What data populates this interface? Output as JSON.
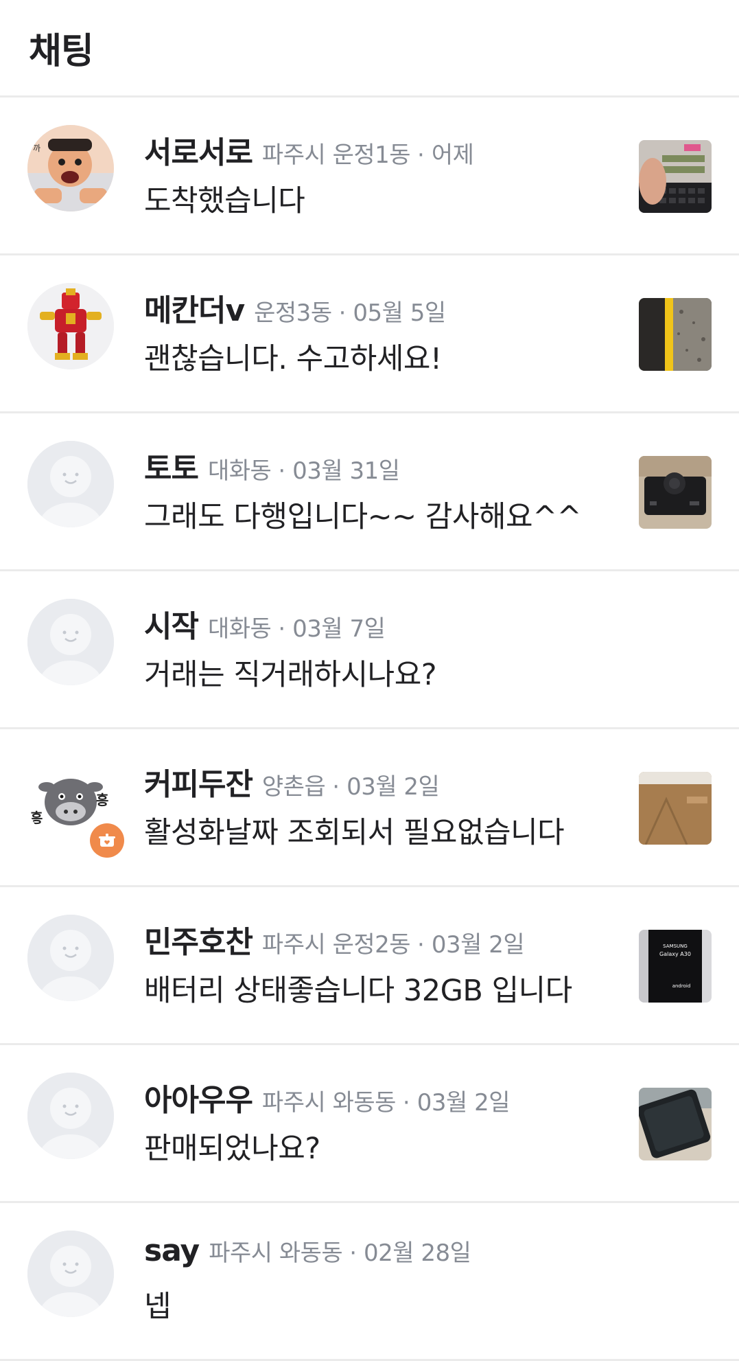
{
  "header": {
    "title": "채팅"
  },
  "chats": [
    {
      "nickname": "서로서로",
      "location": "파주시 운정1동",
      "time": "어제",
      "message": "도착했습니다",
      "avatar": "cartoon-man-avatar",
      "thumbnail": "memory-module-photo"
    },
    {
      "nickname": "메칸더v",
      "location": "운정3동",
      "time": "05월 5일",
      "message": "괜찮습니다. 수고하세요!",
      "avatar": "robot-figure-avatar",
      "thumbnail": "yellow-rod-photo"
    },
    {
      "nickname": "토토",
      "location": "대화동",
      "time": "03월 31일",
      "message": "그래도 다행입니다~~ 감사해요^^",
      "avatar": "default-avatar",
      "thumbnail": "black-device-photo"
    },
    {
      "nickname": "시작",
      "location": "대화동",
      "time": "03월 7일",
      "message": "거래는 직거래하시나요?",
      "avatar": "default-avatar",
      "thumbnail": ""
    },
    {
      "nickname": "커피두잔",
      "location": "양촌읍",
      "time": "03월 2일",
      "message": "활성화날짜 조회되서 필요없습니다",
      "avatar": "cartoon-cow-avatar",
      "thumbnail": "cardboard-box-photo",
      "badge": "orange-pot-badge"
    },
    {
      "nickname": "민주호찬",
      "location": "파주시 운정2동",
      "time": "03월 2일",
      "message": "배터리 상태좋습니다 32GB 입니다",
      "avatar": "default-avatar",
      "thumbnail": "samsung-galaxy-box-photo",
      "thumbnail_text": [
        "SAMSUNG",
        "Galaxy A30",
        "android"
      ]
    },
    {
      "nickname": "아아우우",
      "location": "파주시 와동동",
      "time": "03월 2일",
      "message": "판매되었나요?",
      "avatar": "default-avatar",
      "thumbnail": "smartphone-photo"
    },
    {
      "nickname": "say",
      "location": "파주시 와동동",
      "time": "02월 28일",
      "message": "넵",
      "avatar": "default-avatar",
      "thumbnail": ""
    }
  ],
  "colors": {
    "text_primary": "#212124",
    "text_secondary": "#868b94",
    "divider": "#ebebeb",
    "default_avatar_bg": "#e9ebef",
    "badge": "#f08a4b"
  }
}
